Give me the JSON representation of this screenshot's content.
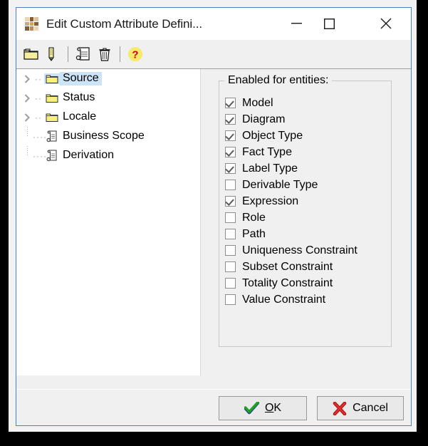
{
  "window": {
    "title": "Edit Custom Attribute Defini...",
    "app_icon": "grid-tiles-icon",
    "controls": {
      "minimize": "minimize-icon",
      "maximize": "maximize-icon",
      "close": "close-icon"
    },
    "border_color": "#4a80c0"
  },
  "toolbar": {
    "buttons": [
      {
        "name": "new-folder-button",
        "icon": "folder-icon",
        "title": "New"
      },
      {
        "name": "edit-button",
        "icon": "pencil-icon",
        "title": "Edit"
      },
      {
        "name": "properties-button",
        "icon": "scroll-search-icon",
        "title": "Properties"
      },
      {
        "name": "delete-button",
        "icon": "trash-icon",
        "title": "Delete"
      },
      {
        "name": "help-button",
        "icon": "question-mark-icon",
        "title": "Help"
      }
    ]
  },
  "tree": {
    "items": [
      {
        "label": "Source",
        "icon": "folder-icon",
        "expandable": true,
        "selected": true
      },
      {
        "label": "Status",
        "icon": "folder-icon",
        "expandable": true,
        "selected": false
      },
      {
        "label": "Locale",
        "icon": "folder-icon",
        "expandable": true,
        "selected": false
      },
      {
        "label": "Business Scope",
        "icon": "scroll-icon",
        "expandable": false,
        "selected": false
      },
      {
        "label": "Derivation",
        "icon": "scroll-icon",
        "expandable": false,
        "selected": false
      }
    ],
    "selection_color": "#cce4f7"
  },
  "entities_group": {
    "legend": "Enabled for entities:",
    "checkboxes": [
      {
        "label": "Model",
        "checked": true
      },
      {
        "label": "Diagram",
        "checked": true
      },
      {
        "label": "Object Type",
        "checked": true
      },
      {
        "label": "Fact Type",
        "checked": true
      },
      {
        "label": "Label Type",
        "checked": true
      },
      {
        "label": "Derivable Type",
        "checked": false
      },
      {
        "label": "Expression",
        "checked": true
      },
      {
        "label": "Role",
        "checked": false
      },
      {
        "label": "Path",
        "checked": false
      },
      {
        "label": "Uniqueness Constraint",
        "checked": false
      },
      {
        "label": "Subset Constraint",
        "checked": false
      },
      {
        "label": "Totality Constraint",
        "checked": false
      },
      {
        "label": "Value Constraint",
        "checked": false
      }
    ]
  },
  "footer": {
    "ok_label": "OK",
    "ok_accesskey": "O",
    "ok_icon": "green-check-icon",
    "cancel_label": "Cancel",
    "cancel_icon": "red-x-icon"
  }
}
